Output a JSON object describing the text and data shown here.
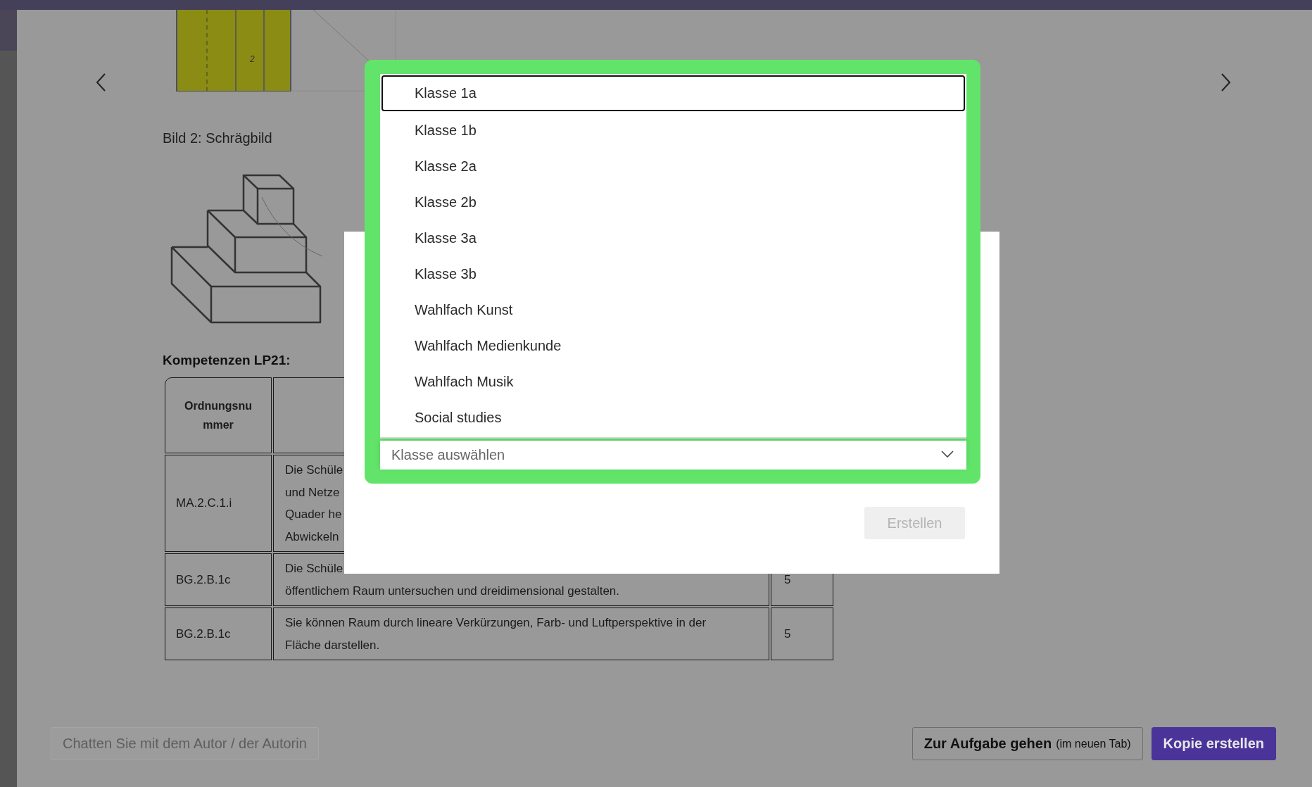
{
  "figure_top": {
    "label": "2"
  },
  "figure_caption": "Bild 2: Schrägbild",
  "section_heading": "Kompetenzen LP21:",
  "table": {
    "columns": [
      "Ordnungsnummer"
    ],
    "rows": [
      {
        "code": "MA.2.C.1.i",
        "description": [
          "Die Schüle",
          "und Netze",
          "Quader he",
          "Abwickeln"
        ]
      },
      {
        "code": "BG.2.B.1c",
        "description": [
          "Die Schüle",
          "öffentlichem Raum untersuchen und dreidimensional gestalten."
        ],
        "column_3": "5"
      },
      {
        "code": "BG.2.B.1c",
        "description": [
          "Sie können Raum durch lineare Verkürzungen, Farb- und Luftperspektive in der Fläche darstellen."
        ],
        "column_3": "5"
      }
    ]
  },
  "footer": {
    "chat_button": {
      "label": "Chatten Sie mit dem Autor / der Autorin",
      "disabled": true
    },
    "open_button": {
      "label": "Zur Aufgabe gehen",
      "note": "(im neuen Tab)"
    },
    "copy_button": {
      "label": "Kopie erstellen"
    }
  },
  "dialog": {
    "class_select": {
      "placeholder": "Klasse auswählen",
      "expanded": true,
      "options": [
        {
          "label": "Klasse 1a",
          "selected": true
        },
        {
          "label": "Klasse 1b",
          "selected": false
        },
        {
          "label": "Klasse 2a",
          "selected": false
        },
        {
          "label": "Klasse 2b",
          "selected": false
        },
        {
          "label": "Klasse 3a",
          "selected": false
        },
        {
          "label": "Klasse 3b",
          "selected": false
        },
        {
          "label": "Wahlfach Kunst",
          "selected": false
        },
        {
          "label": "Wahlfach Medienkunde",
          "selected": false
        },
        {
          "label": "Wahlfach Musik",
          "selected": false
        },
        {
          "label": "Social studies",
          "selected": false
        }
      ]
    },
    "create_button": {
      "label": "Erstellen",
      "disabled": true
    }
  }
}
